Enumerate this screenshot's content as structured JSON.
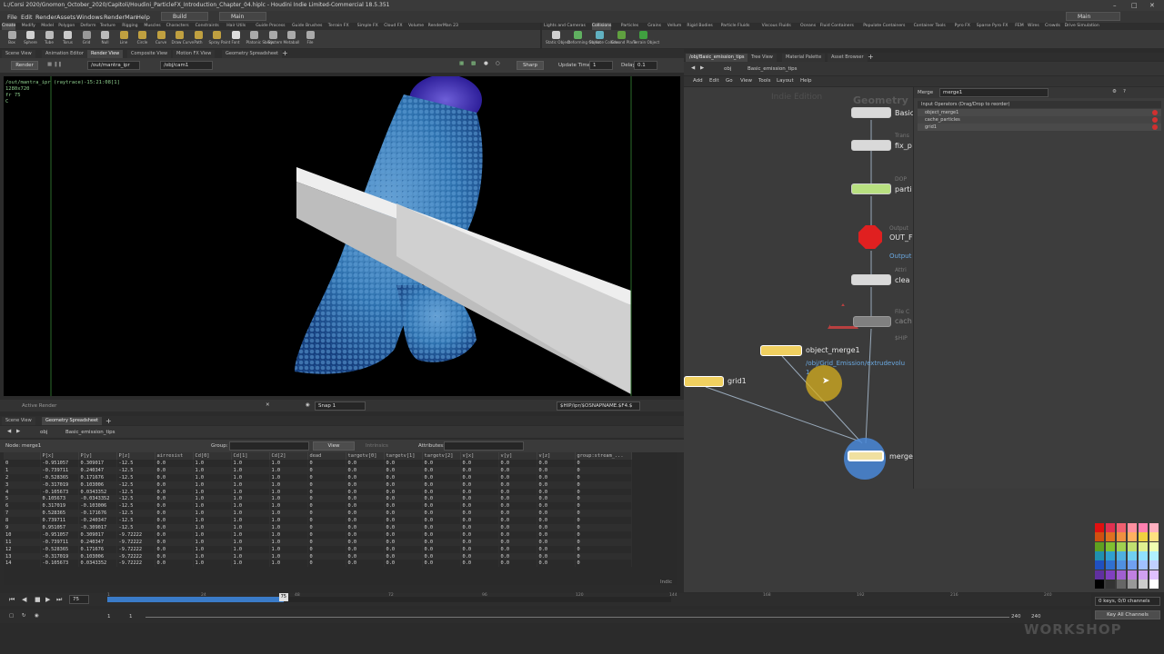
{
  "window": {
    "title": "L:/Corsi 2020/Gnomon_October_2020/Capitoli/Houdini_ParticleFX_Introduction_Chapter_04.hiplc - Houdini Indie Limited-Commercial 18.5.351"
  },
  "menubar": {
    "items": [
      "File",
      "Edit",
      "Render",
      "Assets",
      "Windows",
      "RenderMan",
      "Help"
    ],
    "desktop_left": "Build",
    "desktop_mid": "Main",
    "desktop_right": "Main"
  },
  "shelf_left": {
    "tabs": [
      "Create",
      "Modify",
      "Model",
      "Polygon",
      "Deform",
      "Texture",
      "Rigging",
      "Muscles",
      "Characters",
      "Constraints",
      "Hair Utils",
      "Guide Process",
      "Guide Brushes",
      "Terrain FX",
      "Simple FX",
      "Cloud FX",
      "Volume",
      "RenderMan 23"
    ],
    "tools": [
      "Box",
      "Sphere",
      "Tube",
      "Torus",
      "Grid",
      "Null",
      "Line",
      "Circle",
      "Curve",
      "Draw Curve",
      "Path",
      "Spray Paint",
      "Font",
      "Platonic Solids",
      "L-System",
      "Metaball",
      "File"
    ]
  },
  "shelf_right": {
    "tabs": [
      "Lights and Cameras",
      "Collisions",
      "Particles",
      "Grains",
      "Vellum",
      "Rigid Bodies",
      "Particle Fluids",
      "Viscous Fluids",
      "Oceans",
      "Fluid Containers",
      "Populate Containers",
      "Container Tools",
      "Pyro FX",
      "Sparse Pyro FX",
      "FEM",
      "Wires",
      "Crowds",
      "Drive Simulation"
    ],
    "active_tab": "Collisions",
    "tools": [
      "Static Object",
      "Deforming Object",
      "Surface Collider",
      "Ground Plane",
      "Terrain Object"
    ]
  },
  "left_pane_tabs": [
    "Scene View",
    "Animation Editor",
    "Render View",
    "Composite View",
    "Motion FX View",
    "Geometry Spreadsheet"
  ],
  "render_toolbar": {
    "render_button": "Render",
    "output_path": "/out/mantra_ipr",
    "camera": "/obj/cam1",
    "sharp": "Sharp",
    "update_time_label": "Update Time",
    "update_time": "1",
    "delay_label": "Delay",
    "delay": "0.1"
  },
  "viewport_overlay": {
    "line1": "/out/mantra_ipr (raytrace)-15:21:08[1]",
    "line2": "1280x720",
    "line3": "fr 75",
    "line4": "C"
  },
  "viewport_footer": {
    "active_render": "Active Render",
    "snap": "Snap 1",
    "ship_path": "$HIP/ipr/$OSNAPNAME.$F4.$"
  },
  "lower_tabs": [
    "Scene View",
    "Geometry Spreadsheet"
  ],
  "lower_path": {
    "obj": "obj",
    "node": "Basic_emission_tips"
  },
  "sheet_toolbar": {
    "node_label": "Node: merge1",
    "group_label": "Group:",
    "view": "View",
    "intrinsics": "Intrinsics",
    "attributes_label": "Attributes:"
  },
  "spreadsheet": {
    "columns": [
      "",
      "P[x]",
      "P[y]",
      "P[z]",
      "airresist",
      "Cd[0]",
      "Cd[1]",
      "Cd[2]",
      "dead",
      "targetv[0]",
      "targetv[1]",
      "targetv[2]",
      "v[x]",
      "v[y]",
      "v[z]",
      "group:stream_..."
    ],
    "rows": [
      [
        "0",
        "-0.951057",
        "0.309017",
        "-12.5",
        "0.0",
        "1.0",
        "1.0",
        "1.0",
        "0",
        "0.0",
        "0.0",
        "0.0",
        "0.0",
        "0.0",
        "0.0",
        "0"
      ],
      [
        "1",
        "-0.739711",
        "0.240347",
        "-12.5",
        "0.0",
        "1.0",
        "1.0",
        "1.0",
        "0",
        "0.0",
        "0.0",
        "0.0",
        "0.0",
        "0.0",
        "0.0",
        "0"
      ],
      [
        "2",
        "-0.528365",
        "0.171676",
        "-12.5",
        "0.0",
        "1.0",
        "1.0",
        "1.0",
        "0",
        "0.0",
        "0.0",
        "0.0",
        "0.0",
        "0.0",
        "0.0",
        "0"
      ],
      [
        "3",
        "-0.317019",
        "0.103006",
        "-12.5",
        "0.0",
        "1.0",
        "1.0",
        "1.0",
        "0",
        "0.0",
        "0.0",
        "0.0",
        "0.0",
        "0.0",
        "0.0",
        "0"
      ],
      [
        "4",
        "-0.105673",
        "0.0343352",
        "-12.5",
        "0.0",
        "1.0",
        "1.0",
        "1.0",
        "0",
        "0.0",
        "0.0",
        "0.0",
        "0.0",
        "0.0",
        "0.0",
        "0"
      ],
      [
        "5",
        "0.105673",
        "-0.0343352",
        "-12.5",
        "0.0",
        "1.0",
        "1.0",
        "1.0",
        "0",
        "0.0",
        "0.0",
        "0.0",
        "0.0",
        "0.0",
        "0.0",
        "0"
      ],
      [
        "6",
        "0.317019",
        "-0.103006",
        "-12.5",
        "0.0",
        "1.0",
        "1.0",
        "1.0",
        "0",
        "0.0",
        "0.0",
        "0.0",
        "0.0",
        "0.0",
        "0.0",
        "0"
      ],
      [
        "7",
        "0.528365",
        "-0.171676",
        "-12.5",
        "0.0",
        "1.0",
        "1.0",
        "1.0",
        "0",
        "0.0",
        "0.0",
        "0.0",
        "0.0",
        "0.0",
        "0.0",
        "0"
      ],
      [
        "8",
        "0.739711",
        "-0.240347",
        "-12.5",
        "0.0",
        "1.0",
        "1.0",
        "1.0",
        "0",
        "0.0",
        "0.0",
        "0.0",
        "0.0",
        "0.0",
        "0.0",
        "0"
      ],
      [
        "9",
        "0.951057",
        "-0.309017",
        "-12.5",
        "0.0",
        "1.0",
        "1.0",
        "1.0",
        "0",
        "0.0",
        "0.0",
        "0.0",
        "0.0",
        "0.0",
        "0.0",
        "0"
      ],
      [
        "10",
        "-0.951057",
        "0.309017",
        "-9.72222",
        "0.0",
        "1.0",
        "1.0",
        "1.0",
        "0",
        "0.0",
        "0.0",
        "0.0",
        "0.0",
        "0.0",
        "0.0",
        "0"
      ],
      [
        "11",
        "-0.739711",
        "0.240347",
        "-9.72222",
        "0.0",
        "1.0",
        "1.0",
        "1.0",
        "0",
        "0.0",
        "0.0",
        "0.0",
        "0.0",
        "0.0",
        "0.0",
        "0"
      ],
      [
        "12",
        "-0.528365",
        "0.171676",
        "-9.72222",
        "0.0",
        "1.0",
        "1.0",
        "1.0",
        "0",
        "0.0",
        "0.0",
        "0.0",
        "0.0",
        "0.0",
        "0.0",
        "0"
      ],
      [
        "13",
        "-0.317019",
        "0.103006",
        "-9.72222",
        "0.0",
        "1.0",
        "1.0",
        "1.0",
        "0",
        "0.0",
        "0.0",
        "0.0",
        "0.0",
        "0.0",
        "0.0",
        "0"
      ],
      [
        "14",
        "-0.105673",
        "0.0343352",
        "-9.72222",
        "0.0",
        "1.0",
        "1.0",
        "1.0",
        "0",
        "0.0",
        "0.0",
        "0.0",
        "0.0",
        "0.0",
        "0.0",
        "0"
      ]
    ],
    "footer": "Indic"
  },
  "timeline": {
    "current_frame": "75",
    "ticks": [
      "1",
      "24",
      "48",
      "72",
      "96",
      "120",
      "144",
      "168",
      "192",
      "216",
      "240"
    ],
    "start": "1",
    "start2": "1",
    "end": "240",
    "end2": "240",
    "keys_info": "0 keys, 0/0 channels",
    "key_all": "Key All Channels",
    "progress_fraction": 0.3125
  },
  "right_tabs": [
    "/obj/Basic_emission_tips",
    "Tree View",
    "Material Palette",
    "Asset Browser"
  ],
  "net_path": {
    "obj": "obj",
    "node": "Basic_emission_tips"
  },
  "net_menu": [
    "Add",
    "Edit",
    "Go",
    "View",
    "Tools",
    "Layout",
    "Help"
  ],
  "network": {
    "watermark_edition": "Indie Edition",
    "watermark_context": "Geometry",
    "nodes": {
      "basic": {
        "name": "Basic",
        "type": ""
      },
      "transform": {
        "name": "fix_p",
        "type": "Trans"
      },
      "dop": {
        "name": "parti",
        "type": "DOP"
      },
      "output": {
        "name": "OUT_F",
        "type": "Output",
        "sub": "Output"
      },
      "attrib": {
        "name": "clea",
        "type": "Attri"
      },
      "filecache": {
        "name": "cach",
        "type": "File C",
        "sub": "$HIP"
      },
      "object_merge": {
        "name": "object_merge1",
        "sub": "/obj/Grid_Emission/extrudevolu",
        "sub2": "1"
      },
      "grid": {
        "name": "grid1"
      },
      "merge": {
        "name": "merge"
      }
    }
  },
  "params": {
    "type": "Merge",
    "name": "merge1",
    "section": "Input Operators (Drag/Drop to reorder)",
    "inputs": [
      "object_merge1",
      "cache_particles",
      "grid1"
    ]
  },
  "palette_colors": [
    "#e01010",
    "#e03050",
    "#f06070",
    "#ff90a0",
    "#ff80b0",
    "#ffb0c0",
    "#d05010",
    "#e07020",
    "#f09040",
    "#ffb060",
    "#f0d040",
    "#ffe080",
    "#60a020",
    "#80c030",
    "#a0d050",
    "#c0e070",
    "#e0f090",
    "#f0ffb0",
    "#2090b0",
    "#30a0d0",
    "#50b0e0",
    "#70d0f0",
    "#90e0ff",
    "#b0f0ff",
    "#2050c0",
    "#3070d0",
    "#5090e0",
    "#70a0f0",
    "#a0c0ff",
    "#c0d0ff",
    "#6030a0",
    "#8040c0",
    "#a060d0",
    "#c080e0",
    "#d0a0f0",
    "#e0c0ff",
    "#000000",
    "#333333",
    "#666666",
    "#999999",
    "#cccccc",
    "#ffffff"
  ],
  "branding": {
    "watermark": "WORKSHOP"
  }
}
